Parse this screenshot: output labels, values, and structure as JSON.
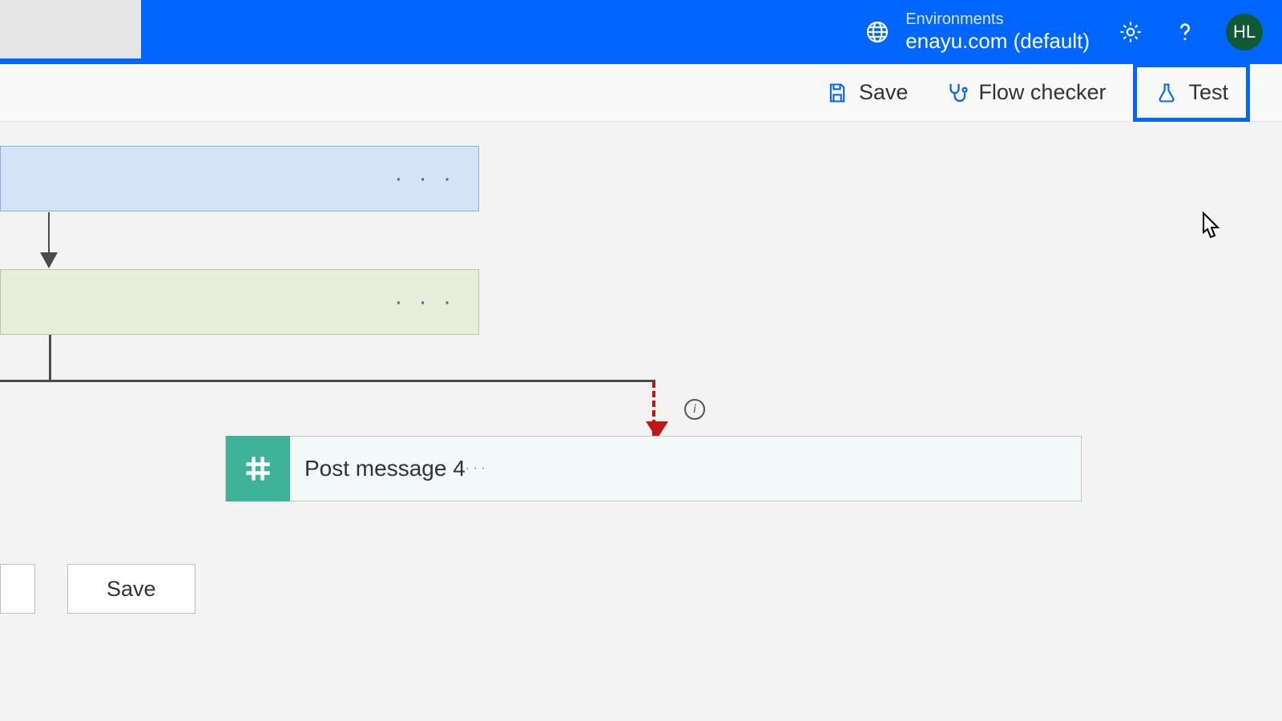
{
  "header": {
    "env_label": "Environments",
    "env_name": "enayu.com (default)",
    "avatar_initials": "HL"
  },
  "toolbar": {
    "save_label": "Save",
    "flow_checker_label": "Flow checker",
    "test_label": "Test"
  },
  "action_card": {
    "title": "Post message 4"
  },
  "bottom": {
    "save_label": "Save"
  }
}
